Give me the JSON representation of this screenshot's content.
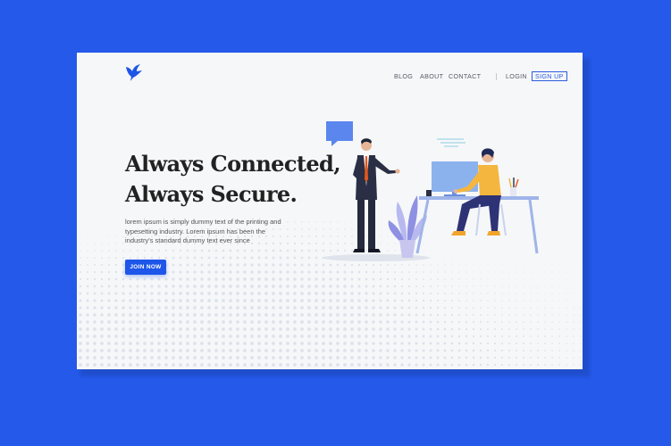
{
  "colors": {
    "background": "#2459ea",
    "card": "#f6f7f9",
    "accent": "#1d56e8",
    "heading": "#222222",
    "body_text": "#555555"
  },
  "logo": {
    "icon": "bird-icon"
  },
  "nav": {
    "items": [
      "BLOG",
      "ABOUT",
      "CONTACT"
    ],
    "login": "LOGIN",
    "signup": "SIGN UP"
  },
  "hero": {
    "headline_line1": "Always Connected,",
    "headline_line2": "Always Secure.",
    "body": "lorem ipsum is simply dummy text of the printing and typesetting industry. Lorem ipsum has been the industry's standard dummy text ever since",
    "cta": "JOIN NOW"
  },
  "illustration": {
    "icons": [
      "speech-bubble-icon",
      "businessman-figure",
      "plant-icon",
      "desk-icon",
      "computer-monitor-icon",
      "worker-figure",
      "pencil-cup-icon",
      "mug-icon"
    ]
  }
}
